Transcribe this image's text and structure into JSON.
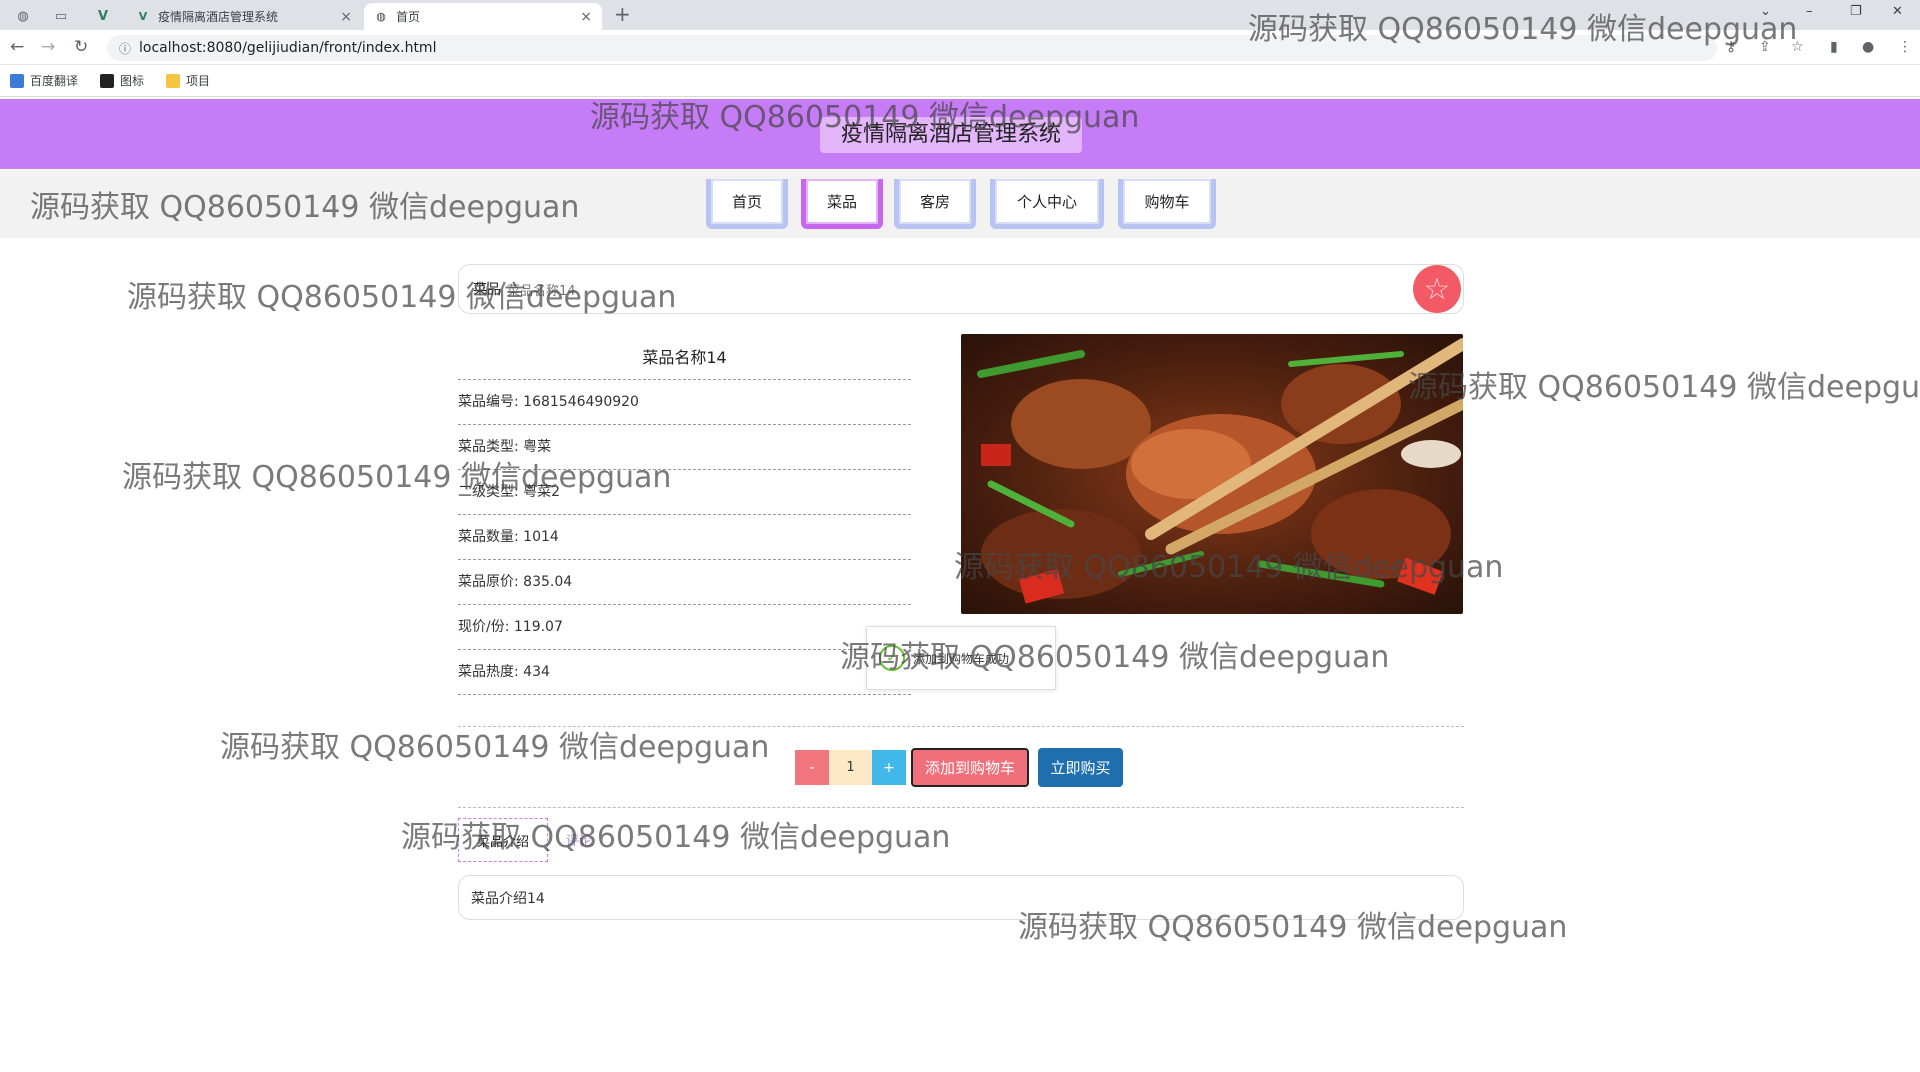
{
  "browser": {
    "tabs": [
      {
        "title": "疫情隔离酒店管理系统",
        "active": false
      },
      {
        "title": "首页",
        "active": true
      }
    ],
    "url": "localhost:8080/gelijiudian/front/index.html",
    "bookmarks": [
      "百度翻译",
      "图标",
      "项目"
    ]
  },
  "site": {
    "title": "疫情隔离酒店管理系统",
    "nav": [
      "首页",
      "菜品",
      "客房",
      "个人中心",
      "购物车"
    ],
    "active_nav": "菜品"
  },
  "search": {
    "label": "菜品",
    "value": "菜品名称14"
  },
  "dish": {
    "name": "菜品名称14",
    "fields": [
      "菜品编号: 1681546490920",
      "菜品类型: 粤菜",
      "二级类型: 粤菜2",
      "菜品数量: 1014",
      "菜品原价: 835.04",
      "现价/份: 119.07",
      "菜品热度: 434"
    ]
  },
  "toast": {
    "message": "添加到购物车成功"
  },
  "actions": {
    "minus": "-",
    "quantity": "1",
    "plus": "+",
    "add_to_cart": "添加到购物车",
    "buy_now": "立即购买"
  },
  "detail_tabs": {
    "intro": "菜品介绍",
    "review": "评论"
  },
  "intro_text": "菜品介绍14",
  "watermark": "源码获取 QQ86050149 微信deepguan",
  "colors": {
    "header": "#c67bf7",
    "active_nav": "#c966ef",
    "nav_border": "#b8c3f2",
    "add_to_cart": "#ef6f7b",
    "buy_now": "#1f6fae"
  }
}
